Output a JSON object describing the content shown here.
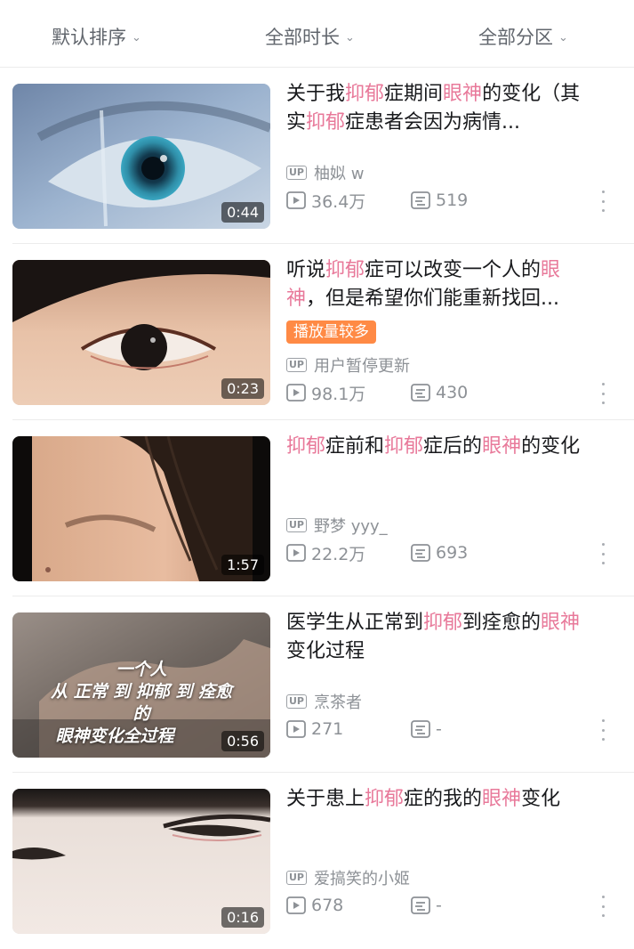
{
  "filters": [
    {
      "label": "默认排序"
    },
    {
      "label": "全部时长"
    },
    {
      "label": "全部分区"
    }
  ],
  "videos": [
    {
      "title_parts": [
        {
          "t": "关于我",
          "hl": false
        },
        {
          "t": "抑郁",
          "hl": true
        },
        {
          "t": "症期间",
          "hl": false
        },
        {
          "t": "眼神",
          "hl": true
        },
        {
          "t": "的变化（其实",
          "hl": false
        },
        {
          "t": "抑郁",
          "hl": true
        },
        {
          "t": "症患者会因为病情...",
          "hl": false
        }
      ],
      "duration": "0:44",
      "badge": "",
      "uploader": "柚姒 w",
      "views": "36.4万",
      "danmaku": "519"
    },
    {
      "title_parts": [
        {
          "t": "听说",
          "hl": false
        },
        {
          "t": "抑郁",
          "hl": true
        },
        {
          "t": "症可以改变一个人的",
          "hl": false
        },
        {
          "t": "眼神",
          "hl": true
        },
        {
          "t": "，但是希望你们能重新找回...",
          "hl": false
        }
      ],
      "duration": "0:23",
      "badge": "播放量较多",
      "uploader": "用户暂停更新",
      "views": "98.1万",
      "danmaku": "430"
    },
    {
      "title_parts": [
        {
          "t": "抑郁",
          "hl": true
        },
        {
          "t": "症前和",
          "hl": false
        },
        {
          "t": "抑郁",
          "hl": true
        },
        {
          "t": "症后的",
          "hl": false
        },
        {
          "t": "眼神",
          "hl": true
        },
        {
          "t": "的变化",
          "hl": false
        }
      ],
      "duration": "1:57",
      "badge": "",
      "uploader": "野梦 yyy_",
      "views": "22.2万",
      "danmaku": "693"
    },
    {
      "title_parts": [
        {
          "t": "医学生从正常到",
          "hl": false
        },
        {
          "t": "抑郁",
          "hl": true
        },
        {
          "t": "到痊愈的",
          "hl": false
        },
        {
          "t": "眼神",
          "hl": true
        },
        {
          "t": "变化过程",
          "hl": false
        }
      ],
      "duration": "0:56",
      "badge": "",
      "overlay_lines": [
        "一个人",
        "从 正常 到 抑郁 到 痊愈",
        "的",
        "眼神变化全过程"
      ],
      "uploader": "烹茶者",
      "views": "271",
      "danmaku": "-"
    },
    {
      "title_parts": [
        {
          "t": "关于患上",
          "hl": false
        },
        {
          "t": "抑郁",
          "hl": true
        },
        {
          "t": "症的我的",
          "hl": false
        },
        {
          "t": "眼神",
          "hl": true
        },
        {
          "t": "变化",
          "hl": false
        }
      ],
      "duration": "0:16",
      "badge": "",
      "uploader": "爱搞笑的小姬",
      "views": "678",
      "danmaku": "-"
    }
  ],
  "labels": {
    "up_tag": "UP"
  },
  "colors": {
    "highlight": "#e8799a",
    "badge": "#ff8a45",
    "meta": "#8d9196"
  }
}
